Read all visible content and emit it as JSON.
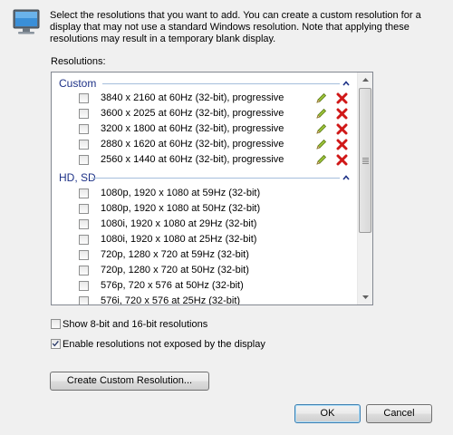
{
  "intro_text": "Select the resolutions that you want to add. You can create a custom resolution for a display that may not use a standard Windows resolution. Note that applying these resolutions may result in a temporary blank display.",
  "resolutions_label": "Resolutions:",
  "groups": {
    "custom": {
      "label": "Custom",
      "items": [
        "3840 x 2160 at 60Hz (32-bit), progressive",
        "3600 x 2025 at 60Hz (32-bit), progressive",
        "3200 x 1800 at 60Hz (32-bit), progressive",
        "2880 x 1620 at 60Hz (32-bit), progressive",
        "2560 x 1440 at 60Hz (32-bit), progressive"
      ]
    },
    "hdsd": {
      "label": "HD, SD",
      "items": [
        "1080p, 1920 x 1080 at 59Hz (32-bit)",
        "1080p, 1920 x 1080 at 50Hz (32-bit)",
        "1080i, 1920 x 1080 at 29Hz (32-bit)",
        "1080i, 1920 x 1080 at 25Hz (32-bit)",
        "720p, 1280 x 720 at 59Hz (32-bit)",
        "720p, 1280 x 720 at 50Hz (32-bit)",
        "576p, 720 x 576 at 50Hz (32-bit)",
        "576i, 720 x 576 at 25Hz (32-bit)"
      ]
    }
  },
  "options": {
    "show_8_16_bit": {
      "label": "Show 8-bit and 16-bit resolutions",
      "checked": false
    },
    "enable_not_exposed": {
      "label": "Enable resolutions not exposed by the display",
      "checked": true
    }
  },
  "buttons": {
    "create_custom": "Create Custom Resolution...",
    "ok": "OK",
    "cancel": "Cancel"
  },
  "icons": {
    "monitor": "monitor-icon",
    "edit": "pencil-icon",
    "delete": "red-x-icon",
    "collapse": "chevron-up-icon"
  },
  "colors": {
    "group_header": "#1e3287",
    "delete_red": "#d01818",
    "edit_green": "#6a9a1a"
  }
}
